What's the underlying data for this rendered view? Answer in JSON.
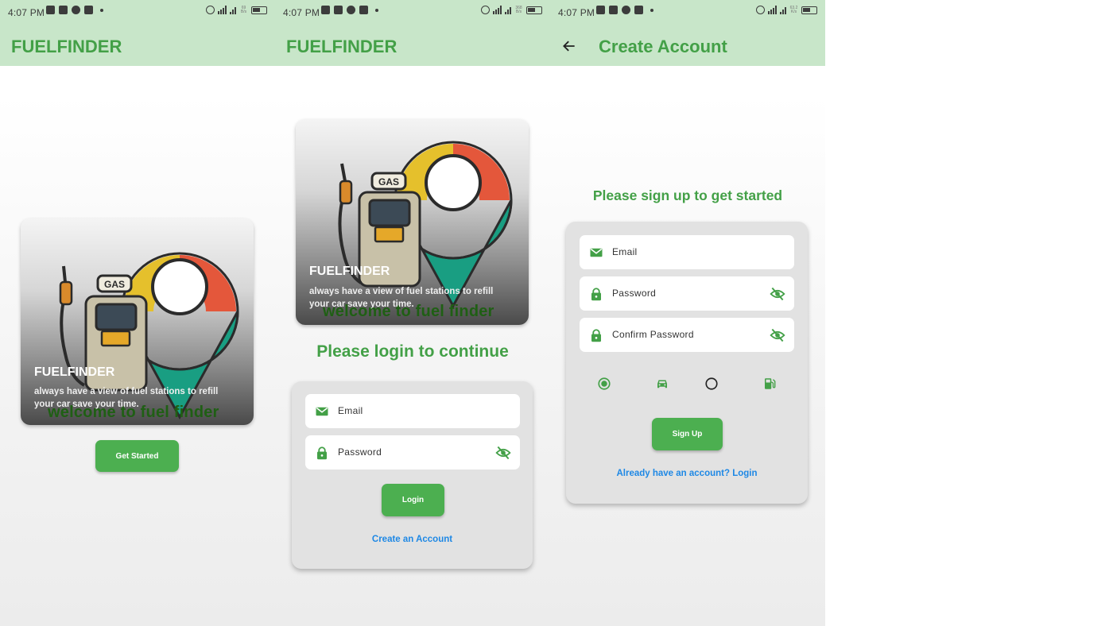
{
  "status_bar": {
    "time": "4:07 PM",
    "net_speed": [
      "69 B/s",
      "368 B/s",
      "63.2 K/s"
    ]
  },
  "colors": {
    "primary": "#43a047",
    "button": "#4caf50",
    "appbar": "#c8e6c9",
    "link": "#1e88e5",
    "card": "#e2e2e2",
    "welcome": "#1f5f14"
  },
  "screens": {
    "welcome": {
      "app_title": "FUELFINDER",
      "hero": {
        "title": "FUELFINDER",
        "subtitle": "always have a view of fuel stations to refill your car,save your time.",
        "overlay": "welcome to fuel finder",
        "badge": "GAS"
      },
      "get_started_label": "Get Started"
    },
    "login": {
      "app_title": "FUELFINDER",
      "hero": {
        "title": "FUELFINDER",
        "subtitle": "always have a view of fuel stations to refill your car,save your time.",
        "overlay": "welcome to fuel finder",
        "badge": "GAS"
      },
      "heading": "Please login to continue",
      "email_label": "Email",
      "password_label": "Password",
      "login_label": "Login",
      "create_account_link": "Create an Account"
    },
    "signup": {
      "app_title": "Create Account",
      "heading": "Please sign up to get started",
      "email_label": "Email",
      "password_label": "Password",
      "confirm_password_label": "Confirm Password",
      "roles": [
        {
          "icon": "radio-selected-icon",
          "selected": true
        },
        {
          "icon": "car-icon"
        },
        {
          "icon": "radio-unselected-icon",
          "selected": false
        },
        {
          "icon": "gas-station-icon"
        }
      ],
      "signup_label": "Sign Up",
      "login_link": "Already have an account? Login"
    }
  }
}
